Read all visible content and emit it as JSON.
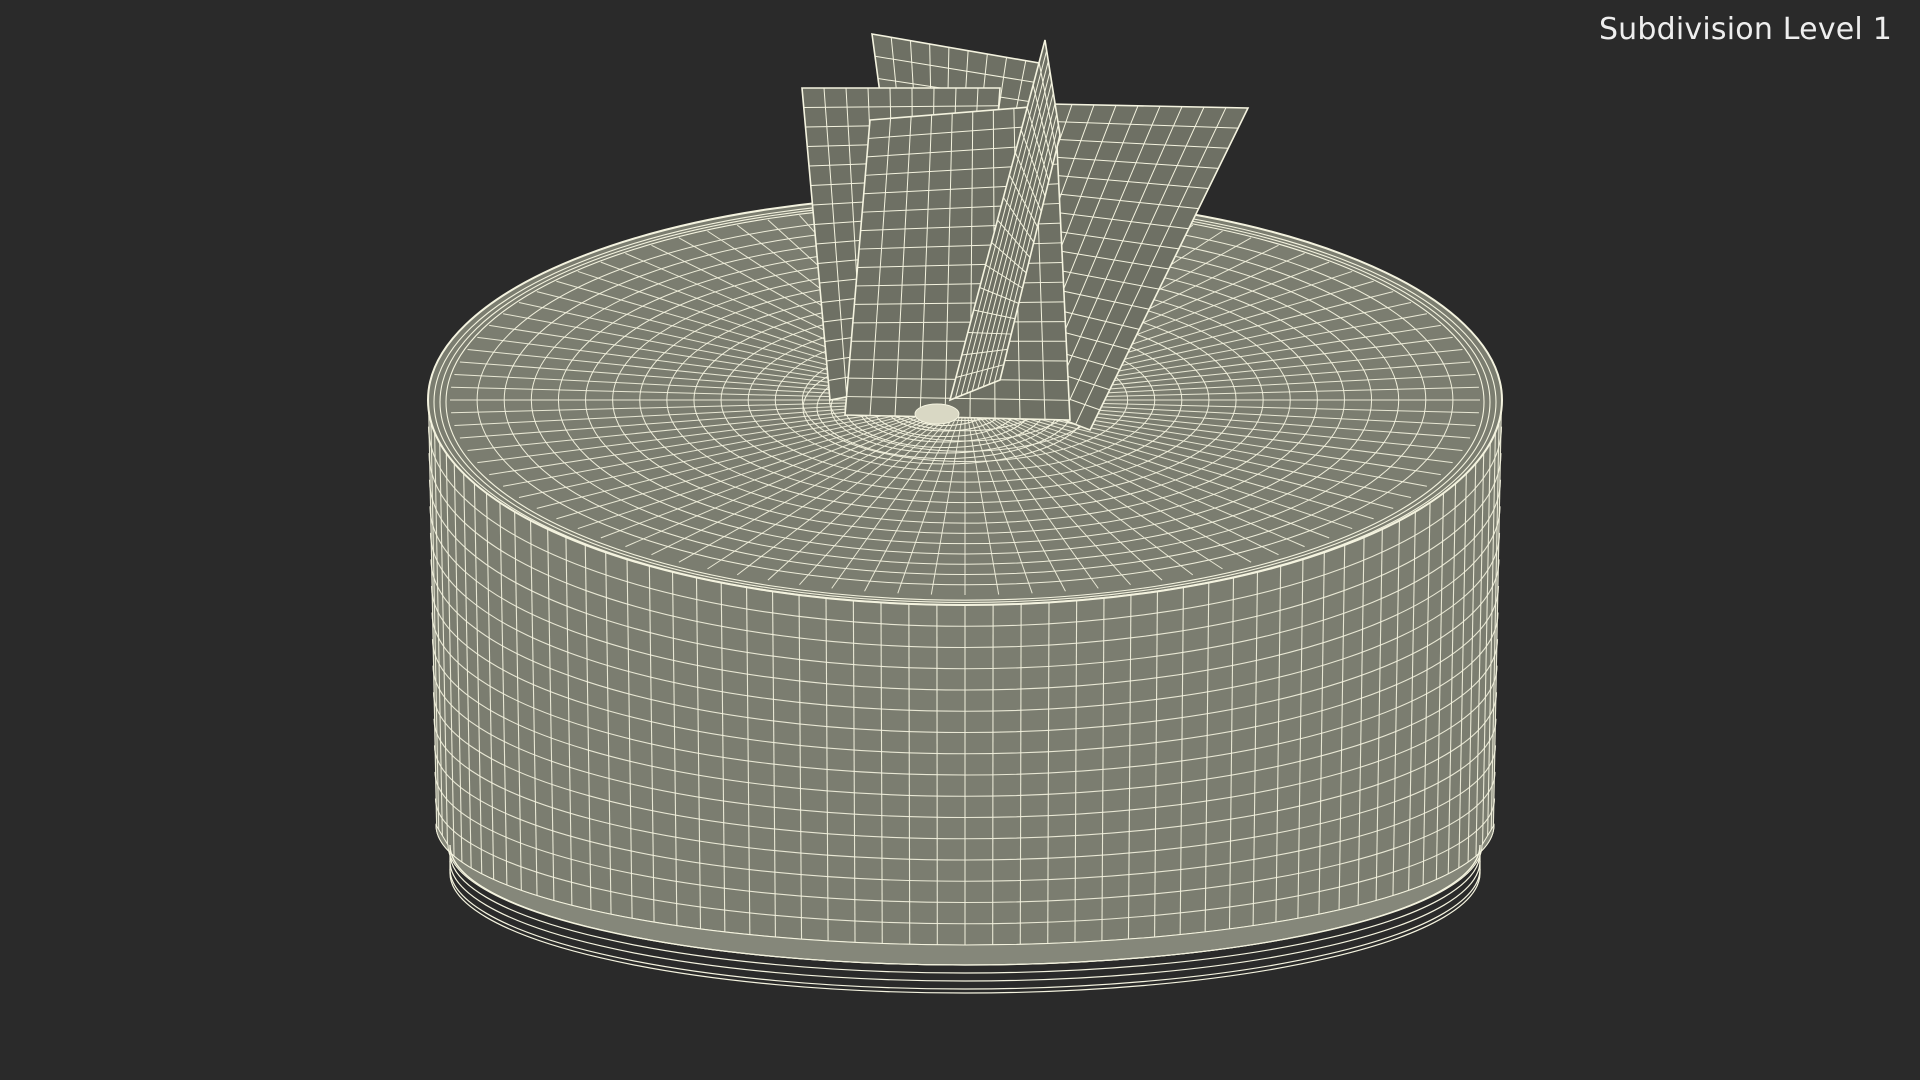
{
  "viewport": {
    "label": "Subdivision Level 1",
    "background_color": "#2a2a2a",
    "surface_color": "#7b7d70",
    "wire_color": "#f4f3df",
    "object": "cylinder-with-twisted-blades"
  }
}
